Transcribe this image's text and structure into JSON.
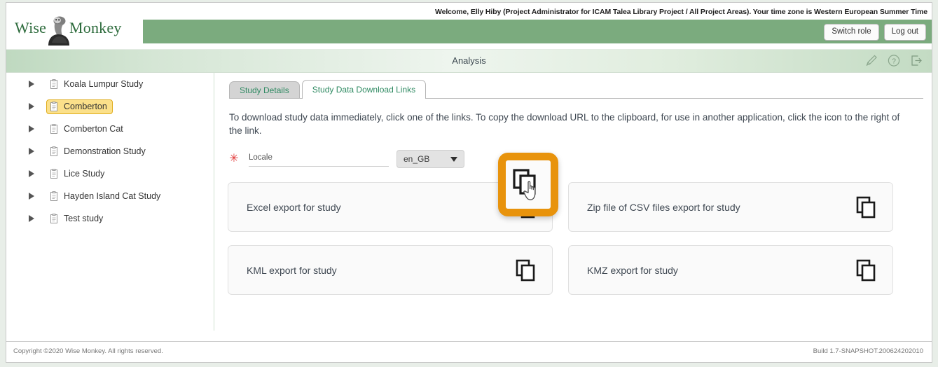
{
  "header": {
    "logo": {
      "word1": "Wise",
      "word2": "Monkey",
      "icon": "monkey-logo-icon"
    },
    "welcome": "Welcome, Elly Hiby (Project Administrator for ICAM Talea Library Project / All Project Areas). Your time zone is Western European Summer Time",
    "switch_role_label": "Switch role",
    "log_out_label": "Log out"
  },
  "titlebar": {
    "title": "Analysis",
    "icons": [
      {
        "name": "pencil-icon"
      },
      {
        "name": "help-icon"
      },
      {
        "name": "exit-icon"
      }
    ]
  },
  "sidebar": {
    "items": [
      {
        "label": "Koala Lumpur Study",
        "selected": false
      },
      {
        "label": "Comberton",
        "selected": true
      },
      {
        "label": "Comberton Cat",
        "selected": false
      },
      {
        "label": "Demonstration Study",
        "selected": false
      },
      {
        "label": "Lice Study",
        "selected": false
      },
      {
        "label": "Hayden Island Cat Study",
        "selected": false
      },
      {
        "label": "Test study",
        "selected": false
      }
    ]
  },
  "tabs": [
    {
      "label": "Study Details",
      "active": false
    },
    {
      "label": "Study Data Download Links",
      "active": true
    }
  ],
  "main": {
    "intro": "To download study data immediately, click one of the links. To copy the download URL to the clipboard, for use in another application, click the icon to the right of the link.",
    "locale": {
      "required_marker": "✳",
      "label": "Locale",
      "value": "en_GB"
    },
    "exports": [
      {
        "label": "Excel export for study",
        "highlighted": true
      },
      {
        "label": "Zip file of CSV files export for study",
        "highlighted": false
      },
      {
        "label": "KML export for study",
        "highlighted": false
      },
      {
        "label": "KMZ export for study",
        "highlighted": false
      }
    ]
  },
  "footer": {
    "copyright": "Copyright ©2020 Wise Monkey. All rights reserved.",
    "build": "Build 1.7-SNAPSHOT.200624202010"
  },
  "colors": {
    "brand_green": "#7bab7e",
    "logo_green": "#2d6b3c",
    "tab_text": "#2f8a62",
    "highlight_orange": "#e8930c",
    "selected_yellow": "#fbe08a",
    "required_red": "#e23b3b"
  }
}
